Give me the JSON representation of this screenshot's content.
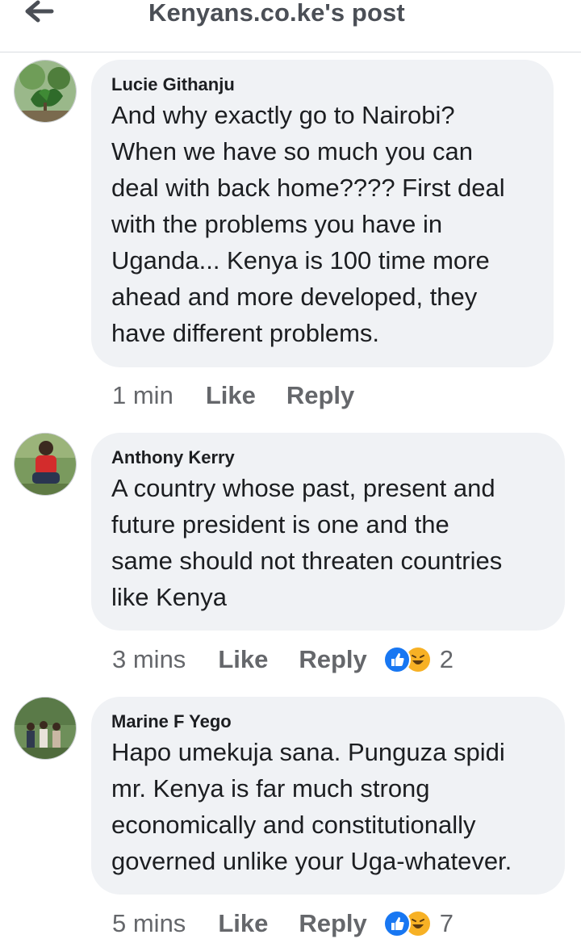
{
  "header": {
    "title": "Kenyans.co.ke's post",
    "back_icon": "arrow-left-icon"
  },
  "comments": [
    {
      "author": "Lucie Githanju",
      "lines": [
        "And why exactly go to Nairobi?",
        "When we have so much you can",
        "deal with back home???? First deal",
        "with the problems you have in",
        "Uganda... Kenya is 100 time more",
        "ahead and more developed, they",
        "have different problems."
      ],
      "time": "1 min",
      "like_label": "Like",
      "reply_label": "Reply"
    },
    {
      "author": "Anthony Kerry",
      "lines": [
        "A country whose past, present and",
        "future president is one and the",
        "same should not threaten countries",
        "like Kenya"
      ],
      "time": "3 mins",
      "like_label": "Like",
      "reply_label": "Reply",
      "reaction_count": "2",
      "reaction_icons": [
        "like-reaction-icon",
        "haha-reaction-icon"
      ]
    },
    {
      "author": "Marine F Yego",
      "lines": [
        "Hapo umekuja sana. Punguza spidi",
        "mr. Kenya is far much strong",
        "economically and constitutionally",
        "governed unlike your Uga-whatever."
      ],
      "time": "5 mins",
      "like_label": "Like",
      "reply_label": "Reply",
      "reaction_count": "7",
      "reaction_icons": [
        "like-reaction-icon",
        "haha-reaction-icon"
      ]
    }
  ],
  "colors": {
    "bubble": "#f0f2f5",
    "meta": "#65676b",
    "like_blue": "#1877f2",
    "haha_yellow": "#f7b125"
  }
}
